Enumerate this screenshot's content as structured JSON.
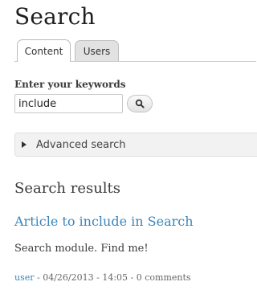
{
  "page": {
    "title": "Search"
  },
  "tabs": [
    {
      "label": "Content",
      "active": true
    },
    {
      "label": "Users",
      "active": false
    }
  ],
  "search_form": {
    "keywords_label": "Enter your keywords",
    "keywords_value": "include",
    "submit_icon": "search-icon"
  },
  "advanced_search": {
    "label": "Advanced search",
    "icon": "triangle-right-icon",
    "expanded": false
  },
  "results": {
    "heading": "Search results",
    "items": [
      {
        "title": "Article to include in Search",
        "snippet": "Search module. Find me!",
        "author": "user",
        "meta_rest": " - 04/26/2013 - 14:05 - 0 comments"
      }
    ]
  },
  "colors": {
    "link": "#3b85bb",
    "text": "#3b3b3b",
    "tab_inactive": "#e2e2e2"
  }
}
